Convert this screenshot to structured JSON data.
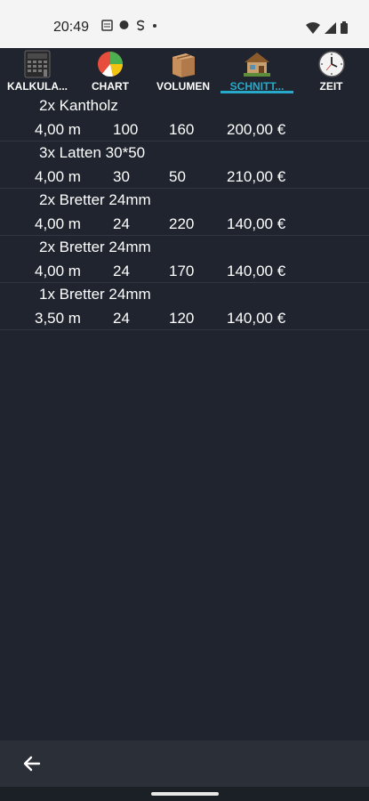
{
  "status": {
    "time": "20:49"
  },
  "tabs": [
    {
      "label": "KALKULA...",
      "icon": "calculator-icon"
    },
    {
      "label": "CHART",
      "icon": "pie-chart-icon"
    },
    {
      "label": "VOLUMEN",
      "icon": "box-icon"
    },
    {
      "label": "SCHNITT...",
      "icon": "house-icon"
    },
    {
      "label": "ZEIT",
      "icon": "clock-icon"
    }
  ],
  "items": [
    {
      "title": "2x Kantholz",
      "length": "4,00 m",
      "a": "100",
      "b": "160",
      "price": "200,00 €"
    },
    {
      "title": "3x Latten 30*50",
      "length": "4,00 m",
      "a": "30",
      "b": "50",
      "price": "210,00 €"
    },
    {
      "title": "2x Bretter 24mm",
      "length": "4,00 m",
      "a": "24",
      "b": "220",
      "price": "140,00 €"
    },
    {
      "title": "2x Bretter 24mm",
      "length": "4,00 m",
      "a": "24",
      "b": "170",
      "price": "140,00 €"
    },
    {
      "title": "1x Bretter 24mm",
      "length": "3,50 m",
      "a": "24",
      "b": "120",
      "price": "140,00 €"
    }
  ],
  "colors": {
    "accent": "#29a9c9",
    "background": "#1f242e"
  }
}
